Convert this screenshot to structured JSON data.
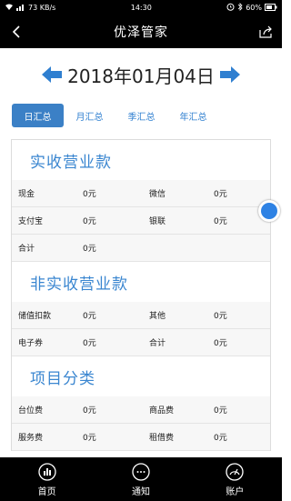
{
  "status": {
    "carrier": "73 KB/s",
    "time": "14:30",
    "battery": "60%"
  },
  "header": {
    "title": "优泽管家"
  },
  "date": {
    "value": "2018年01月04日"
  },
  "tabs": [
    {
      "label": "日汇总",
      "active": true
    },
    {
      "label": "月汇总",
      "active": false
    },
    {
      "label": "季汇总",
      "active": false
    },
    {
      "label": "年汇总",
      "active": false
    }
  ],
  "sections": [
    {
      "title": "实收营业款",
      "rows": [
        [
          "现金",
          "0元",
          "微信",
          "0元"
        ],
        [
          "支付宝",
          "0元",
          "银联",
          "0元"
        ],
        [
          "合计",
          "0元",
          "",
          ""
        ]
      ]
    },
    {
      "title": "非实收营业款",
      "rows": [
        [
          "储值扣款",
          "0元",
          "其他",
          "0元"
        ],
        [
          "电子券",
          "0元",
          "合计",
          "0元"
        ]
      ]
    },
    {
      "title": "项目分类",
      "rows": [
        [
          "台位费",
          "0元",
          "商品费",
          "0元"
        ],
        [
          "服务费",
          "0元",
          "租借费",
          "0元"
        ]
      ]
    }
  ],
  "bottom_nav": [
    {
      "label": "首页",
      "icon": "chart-icon"
    },
    {
      "label": "通知",
      "icon": "chat-icon"
    },
    {
      "label": "账户",
      "icon": "gauge-icon"
    }
  ],
  "colors": {
    "accent": "#3a86d0",
    "tab_active": "#3b80c6",
    "float": "#2e82e4"
  }
}
